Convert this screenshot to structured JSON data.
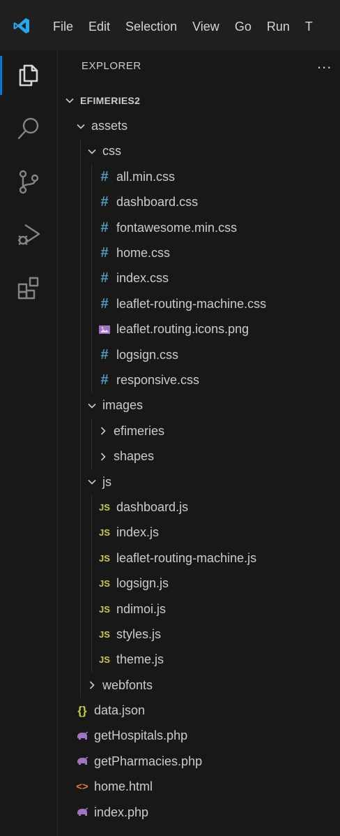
{
  "menu": [
    "File",
    "Edit",
    "Selection",
    "View",
    "Go",
    "Run",
    "T"
  ],
  "sidebar": {
    "title": "EXPLORER",
    "more": "..."
  },
  "tree": [
    {
      "label": "EFIMERIES2",
      "type": "folder-open",
      "depth": 0,
      "root": true
    },
    {
      "label": "assets",
      "type": "folder-open",
      "depth": 1
    },
    {
      "label": "css",
      "type": "folder-open",
      "depth": 2
    },
    {
      "label": "all.min.css",
      "type": "css",
      "depth": 3
    },
    {
      "label": "dashboard.css",
      "type": "css",
      "depth": 3
    },
    {
      "label": "fontawesome.min.css",
      "type": "css",
      "depth": 3
    },
    {
      "label": "home.css",
      "type": "css",
      "depth": 3
    },
    {
      "label": "index.css",
      "type": "css",
      "depth": 3
    },
    {
      "label": "leaflet-routing-machine.css",
      "type": "css",
      "depth": 3
    },
    {
      "label": "leaflet.routing.icons.png",
      "type": "png",
      "depth": 3
    },
    {
      "label": "logsign.css",
      "type": "css",
      "depth": 3
    },
    {
      "label": "responsive.css",
      "type": "css",
      "depth": 3
    },
    {
      "label": "images",
      "type": "folder-open",
      "depth": 2
    },
    {
      "label": "efimeries",
      "type": "folder-closed",
      "depth": 3
    },
    {
      "label": "shapes",
      "type": "folder-closed",
      "depth": 3
    },
    {
      "label": "js",
      "type": "folder-open",
      "depth": 2
    },
    {
      "label": "dashboard.js",
      "type": "js",
      "depth": 3
    },
    {
      "label": "index.js",
      "type": "js",
      "depth": 3
    },
    {
      "label": "leaflet-routing-machine.js",
      "type": "js",
      "depth": 3
    },
    {
      "label": "logsign.js",
      "type": "js",
      "depth": 3
    },
    {
      "label": "ndimoi.js",
      "type": "js",
      "depth": 3
    },
    {
      "label": "styles.js",
      "type": "js",
      "depth": 3
    },
    {
      "label": "theme.js",
      "type": "js",
      "depth": 3
    },
    {
      "label": "webfonts",
      "type": "folder-closed",
      "depth": 2
    },
    {
      "label": "data.json",
      "type": "json",
      "depth": 1
    },
    {
      "label": "getHospitals.php",
      "type": "php",
      "depth": 1
    },
    {
      "label": "getPharmacies.php",
      "type": "php",
      "depth": 1
    },
    {
      "label": "home.html",
      "type": "html",
      "depth": 1
    },
    {
      "label": "index.php",
      "type": "php",
      "depth": 1
    }
  ],
  "icon_glyphs": {
    "css": "#",
    "js": "JS",
    "json": "{}",
    "html": "<>"
  },
  "colors": {
    "accent": "#0078d4",
    "css": "#519aba",
    "js": "#cbcb41",
    "php": "#a074c4",
    "html": "#e37933"
  }
}
